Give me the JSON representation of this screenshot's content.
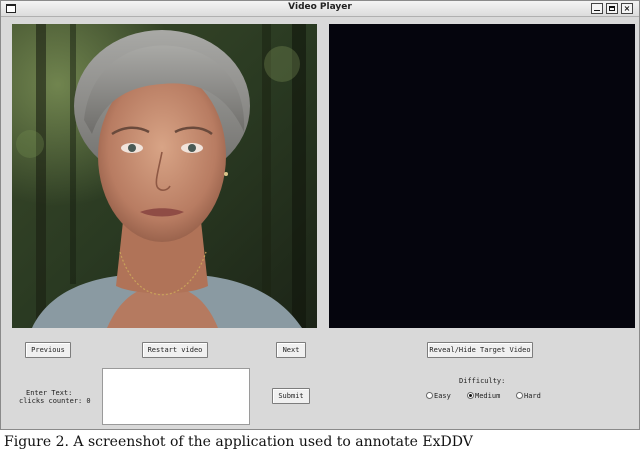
{
  "window": {
    "title": "Video Player",
    "close_glyph": "×"
  },
  "icons": {
    "app": "window-icon",
    "minimize": "minimize-icon",
    "maximize": "maximize-icon",
    "close": "close-icon"
  },
  "videos": {
    "left": "face-video-frame",
    "right": "target-video-hidden"
  },
  "controls": {
    "previous_label": "Previous",
    "restart_label": "Restart video",
    "next_label": "Next",
    "reveal_label": "Reveal/Hide Target Video",
    "submit_label": "Submit"
  },
  "input": {
    "enter_text_label": "Enter Text:",
    "clicks_counter_label": "clicks counter: 0",
    "value": ""
  },
  "difficulty": {
    "label": "Difficulty:",
    "options": [
      "Easy",
      "Medium",
      "Hard"
    ],
    "selected": "Medium"
  },
  "caption": "Figure 2. A screenshot of the application used to annotate ExDDV"
}
